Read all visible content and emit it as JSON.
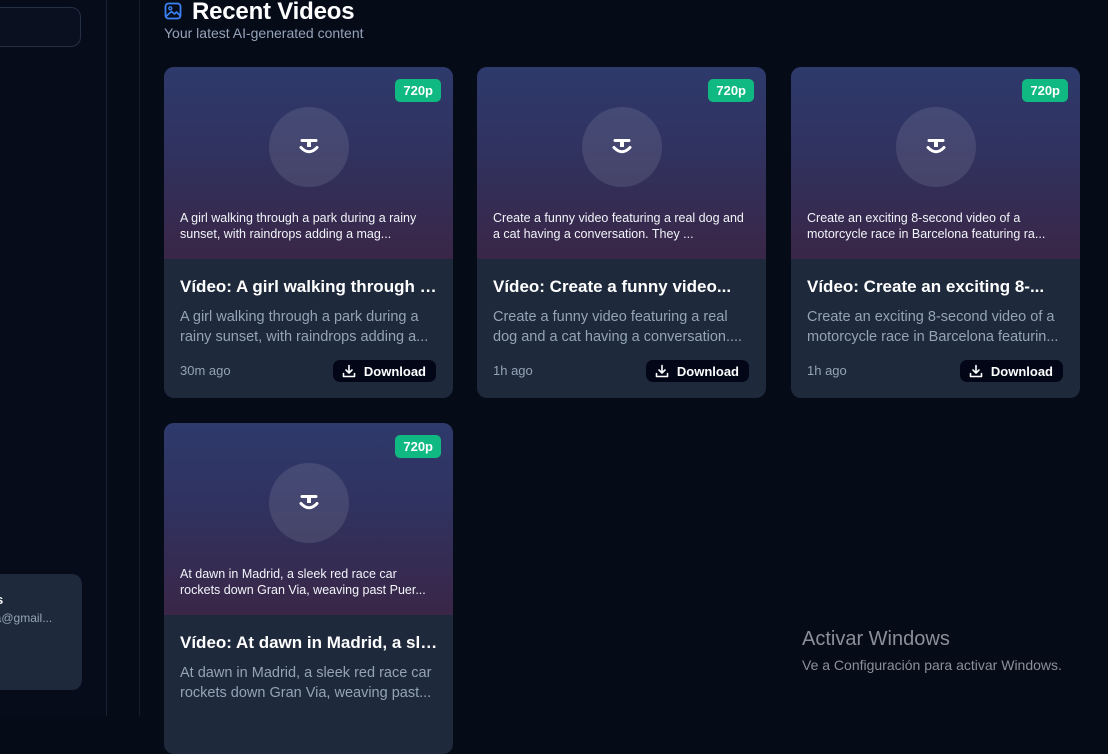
{
  "sidebar": {
    "user": {
      "name": "os",
      "email": "ria@gmail..."
    }
  },
  "header": {
    "icon": "image-icon",
    "title": "Recent Videos",
    "subtitle": "Your latest AI-generated content"
  },
  "videos": [
    {
      "resolution": "720p",
      "prompt": "A girl walking through a park during a rainy sunset, with raindrops adding a mag...",
      "title": "Vídeo: A girl walking through a...",
      "description": "A girl walking through a park during a rainy sunset, with raindrops adding a...",
      "time": "30m ago",
      "download_label": "Download"
    },
    {
      "resolution": "720p",
      "prompt": "Create a funny video featuring a real dog and a cat having a conversation. They ...",
      "title": "Vídeo: Create a funny video...",
      "description": "Create a funny video featuring a real dog and a cat having a conversation....",
      "time": "1h ago",
      "download_label": "Download"
    },
    {
      "resolution": "720p",
      "prompt": "Create an exciting 8-second video of a motorcycle race in Barcelona featuring ra...",
      "title": "Vídeo: Create an exciting 8-...",
      "description": "Create an exciting 8-second video of a motorcycle race in Barcelona featurin...",
      "time": "1h ago",
      "download_label": "Download"
    },
    {
      "resolution": "720p",
      "prompt": "At dawn in Madrid, a sleek red race car rockets down Gran Via, weaving past Puer...",
      "title": "Vídeo: At dawn in Madrid, a slee...",
      "description": "At dawn in Madrid, a sleek red race car rockets down Gran Via, weaving past...",
      "time": "",
      "download_label": "Download"
    }
  ],
  "watermark": {
    "title": "Activar Windows",
    "subtitle": "Ve a Configuración para activar Windows."
  },
  "colors": {
    "background": "#060b18",
    "card": "#1e293b",
    "badge": "#10b981",
    "accent_icon": "#3b82f6"
  }
}
